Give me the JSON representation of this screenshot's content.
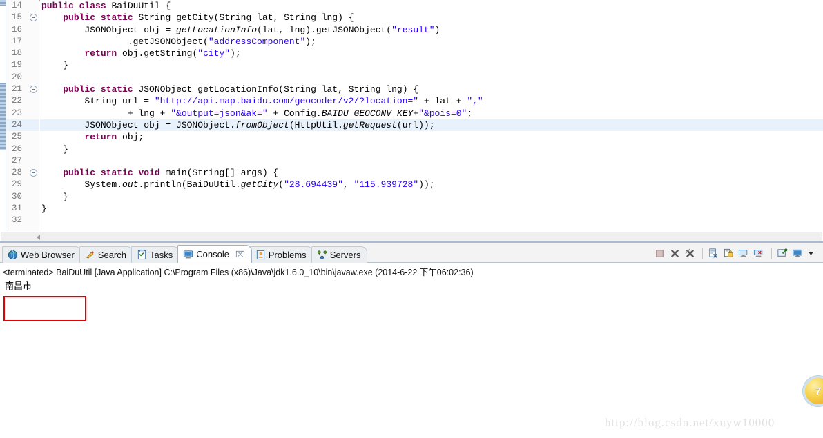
{
  "editor": {
    "lines": [
      {
        "num": "14",
        "fold": false,
        "current": false,
        "tokens": [
          {
            "t": "public",
            "c": "kw"
          },
          {
            "t": " "
          },
          {
            "t": "class",
            "c": "kw"
          },
          {
            "t": " BaiDuUtil {"
          }
        ]
      },
      {
        "num": "15",
        "fold": true,
        "current": false,
        "tokens": [
          {
            "t": "    "
          },
          {
            "t": "public",
            "c": "kw"
          },
          {
            "t": " "
          },
          {
            "t": "static",
            "c": "kw"
          },
          {
            "t": " String getCity(String lat, String lng) {"
          }
        ]
      },
      {
        "num": "16",
        "fold": false,
        "current": false,
        "tokens": [
          {
            "t": "        JSONObject obj = "
          },
          {
            "t": "getLocationInfo",
            "c": "ital"
          },
          {
            "t": "(lat, lng).getJSONObject("
          },
          {
            "t": "\"result\"",
            "c": "str"
          },
          {
            "t": ")"
          }
        ]
      },
      {
        "num": "17",
        "fold": false,
        "current": false,
        "tokens": [
          {
            "t": "                .getJSONObject("
          },
          {
            "t": "\"addressComponent\"",
            "c": "str"
          },
          {
            "t": ");"
          }
        ]
      },
      {
        "num": "18",
        "fold": false,
        "current": false,
        "tokens": [
          {
            "t": "        "
          },
          {
            "t": "return",
            "c": "kw"
          },
          {
            "t": " obj.getString("
          },
          {
            "t": "\"city\"",
            "c": "str"
          },
          {
            "t": ");"
          }
        ]
      },
      {
        "num": "19",
        "fold": false,
        "current": false,
        "tokens": [
          {
            "t": "    }"
          }
        ]
      },
      {
        "num": "20",
        "fold": false,
        "current": false,
        "tokens": [
          {
            "t": ""
          }
        ]
      },
      {
        "num": "21",
        "fold": true,
        "current": false,
        "tokens": [
          {
            "t": "    "
          },
          {
            "t": "public",
            "c": "kw"
          },
          {
            "t": " "
          },
          {
            "t": "static",
            "c": "kw"
          },
          {
            "t": " JSONObject getLocationInfo(String lat, String lng) {"
          }
        ]
      },
      {
        "num": "22",
        "fold": false,
        "current": false,
        "tokens": [
          {
            "t": "        String url = "
          },
          {
            "t": "\"http://api.map.baidu.com/geocoder/v2/?location=\"",
            "c": "str"
          },
          {
            "t": " + lat + "
          },
          {
            "t": "\",\"",
            "c": "str"
          }
        ]
      },
      {
        "num": "23",
        "fold": false,
        "current": false,
        "tokens": [
          {
            "t": "                + lng + "
          },
          {
            "t": "\"&output=json&ak=\"",
            "c": "str"
          },
          {
            "t": " + Config."
          },
          {
            "t": "BAIDU_GEOCONV_KEY",
            "c": "fld"
          },
          {
            "t": "+"
          },
          {
            "t": "\"&pois=0\"",
            "c": "str"
          },
          {
            "t": ";"
          }
        ]
      },
      {
        "num": "24",
        "fold": false,
        "current": true,
        "tokens": [
          {
            "t": "        JSONObject obj = JSONObject."
          },
          {
            "t": "fromObject",
            "c": "ital"
          },
          {
            "t": "(HttpUtil."
          },
          {
            "t": "getRequest",
            "c": "ital"
          },
          {
            "t": "(url));"
          }
        ]
      },
      {
        "num": "25",
        "fold": false,
        "current": false,
        "tokens": [
          {
            "t": "        "
          },
          {
            "t": "return",
            "c": "kw"
          },
          {
            "t": " obj;"
          }
        ]
      },
      {
        "num": "26",
        "fold": false,
        "current": false,
        "tokens": [
          {
            "t": "    }"
          }
        ]
      },
      {
        "num": "27",
        "fold": false,
        "current": false,
        "tokens": [
          {
            "t": ""
          }
        ]
      },
      {
        "num": "28",
        "fold": true,
        "current": false,
        "tokens": [
          {
            "t": "    "
          },
          {
            "t": "public",
            "c": "kw"
          },
          {
            "t": " "
          },
          {
            "t": "static",
            "c": "kw"
          },
          {
            "t": " "
          },
          {
            "t": "void",
            "c": "kw"
          },
          {
            "t": " main(String[] args) {"
          }
        ]
      },
      {
        "num": "29",
        "fold": false,
        "current": false,
        "tokens": [
          {
            "t": "        System."
          },
          {
            "t": "out",
            "c": "fld"
          },
          {
            "t": ".println(BaiDuUtil."
          },
          {
            "t": "getCity",
            "c": "ital"
          },
          {
            "t": "("
          },
          {
            "t": "\"28.694439\"",
            "c": "str"
          },
          {
            "t": ", "
          },
          {
            "t": "\"115.939728\"",
            "c": "str"
          },
          {
            "t": "));"
          }
        ]
      },
      {
        "num": "30",
        "fold": false,
        "current": false,
        "tokens": [
          {
            "t": "    }"
          }
        ]
      },
      {
        "num": "31",
        "fold": false,
        "current": false,
        "tokens": [
          {
            "t": "}"
          }
        ]
      },
      {
        "num": "32",
        "fold": false,
        "current": false,
        "tokens": [
          {
            "t": ""
          }
        ]
      }
    ],
    "colors": {
      "keyword": "#7f0055",
      "string": "#2a00ff",
      "current_line": "#e8f2fd"
    }
  },
  "panel": {
    "tabs": [
      {
        "label": "Web Browser",
        "icon": "globe-icon",
        "active": false,
        "closable": false
      },
      {
        "label": "Search",
        "icon": "search-icon",
        "active": false,
        "closable": false
      },
      {
        "label": "Tasks",
        "icon": "tasks-icon",
        "active": false,
        "closable": false
      },
      {
        "label": "Console",
        "icon": "console-icon",
        "active": true,
        "closable": true,
        "close_glyph": "⌧"
      },
      {
        "label": "Problems",
        "icon": "problems-icon",
        "active": false,
        "closable": false
      },
      {
        "label": "Servers",
        "icon": "servers-icon",
        "active": false,
        "closable": false
      }
    ],
    "toolbar": [
      {
        "name": "terminate-button",
        "title": "Terminate"
      },
      {
        "name": "remove-launch-button",
        "title": "Remove Launch"
      },
      {
        "name": "remove-all-terminated-button",
        "title": "Remove All Terminated Launches"
      },
      {
        "name": "clear-console-button",
        "title": "Clear Console"
      },
      {
        "name": "scroll-lock-button",
        "title": "Scroll Lock"
      },
      {
        "name": "show-console-button",
        "title": "Show Console When Output Changes"
      },
      {
        "name": "show-console-error-button",
        "title": "Show Console On Error"
      },
      {
        "name": "pin-console-button",
        "title": "Pin Console"
      },
      {
        "name": "display-selected-console-button",
        "title": "Display Selected Console"
      },
      {
        "name": "open-console-dropdown",
        "title": "Open Console"
      }
    ]
  },
  "console": {
    "header": "<terminated> BaiDuUtil [Java Application] C:\\Program Files (x86)\\Java\\jdk1.6.0_10\\bin\\javaw.exe (2014-6-22 下午06:02:36)",
    "output": "南昌市",
    "highlight_color": "#e40000"
  },
  "watermark": {
    "text": "http://blog.csdn.net/xuyw10000"
  },
  "badge": {
    "text": "7"
  }
}
